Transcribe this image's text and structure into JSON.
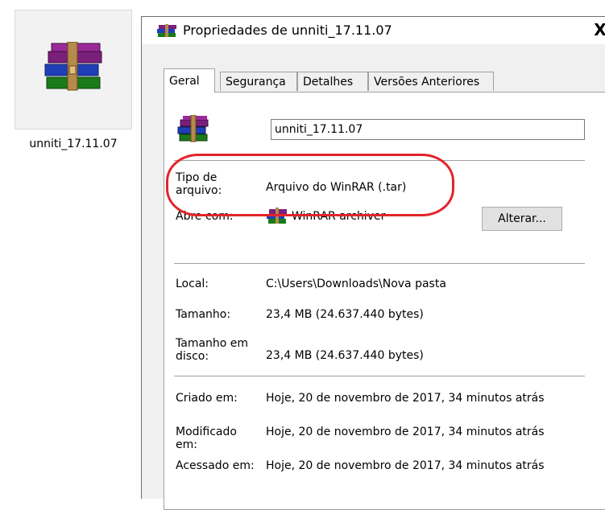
{
  "desktop_icon": {
    "label": "unniti_17.11.07",
    "icon": "winrar-archive-icon"
  },
  "dialog": {
    "title": "Propriedades de unniti_17.11.07",
    "close_glyph": "X",
    "tabs": [
      "Geral",
      "Segurança",
      "Detalhes",
      "Versões Anteriores"
    ],
    "active_tab": "Geral",
    "filename": "unniti_17.11.07",
    "fields": {
      "tipo_label": "Tipo de\narquivo:",
      "tipo_value": "Arquivo do WinRAR (.tar)",
      "abre_label": "Abre com:",
      "abre_value": "WinRAR archiver",
      "alterar_button": "Alterar...",
      "local_label": "Local:",
      "local_value": "C:\\Users\\Downloads\\Nova pasta",
      "tamanho_label": "Tamanho:",
      "tamanho_value": "23,4 MB (24.637.440 bytes)",
      "tamanho_disco_label": "Tamanho em\ndisco:",
      "tamanho_disco_value": "23,4 MB (24.637.440 bytes)",
      "criado_label": "Criado em:",
      "criado_value": "Hoje, 20 de novembro de 2017, 34 minutos atrás",
      "modificado_label": "Modificado\nem:",
      "modificado_value": "Hoje, 20 de novembro de 2017, 34 minutos atrás",
      "acessado_label": "Acessado em:",
      "acessado_value": "Hoje, 20 de novembro de 2017, 34 minutos atrás"
    }
  },
  "colors": {
    "highlight": "#e3242b",
    "panel": "#ffffff",
    "dialog_bg": "#f0f0f0"
  }
}
